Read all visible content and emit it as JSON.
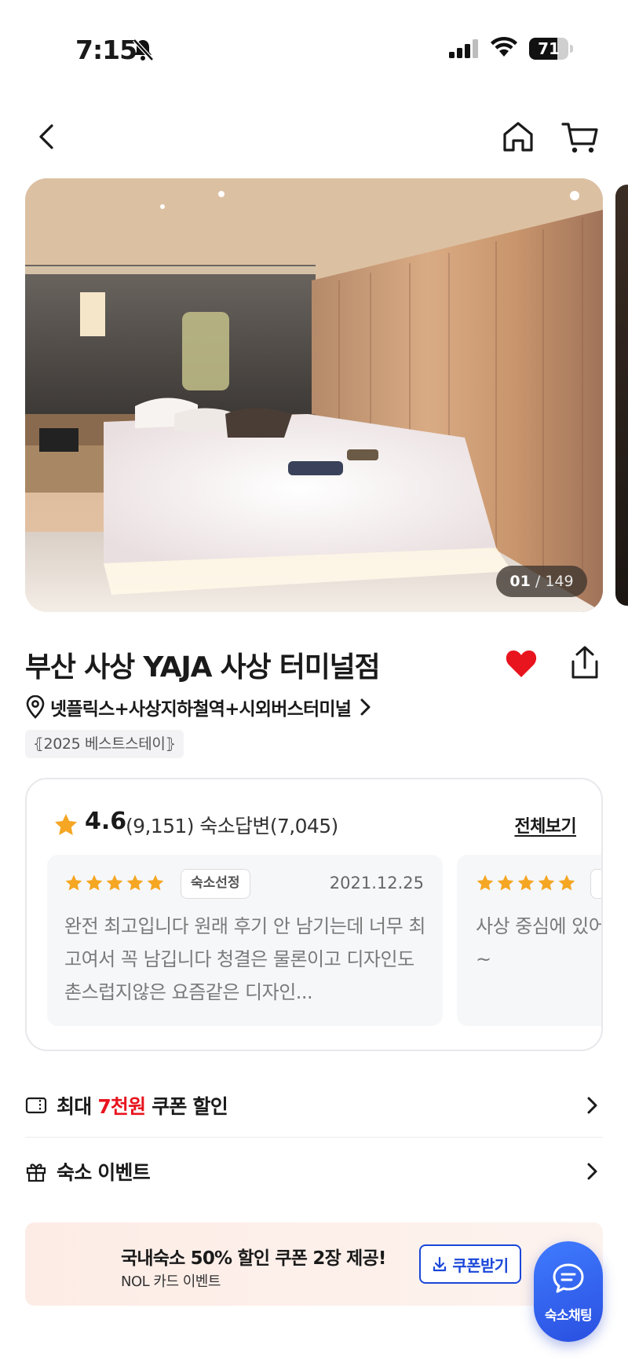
{
  "status_bar": {
    "time": "7:15",
    "battery": "71",
    "battery_level": 0.71
  },
  "gallery": {
    "current": "01",
    "separator": "/",
    "total": "149"
  },
  "hotel": {
    "name": "부산 사상 YAJA 사상 터미널점",
    "location": "넷플릭스+사상지하철역+시외버스터미널",
    "badge": "2025 베스트스테이",
    "liked": true
  },
  "reviews": {
    "rating": "4.6",
    "count_text": "(9,151) 숙소답변(7,045)",
    "view_all_label": "전체보기",
    "items": [
      {
        "stars": 5,
        "tag": "숙소선정",
        "date": "2021.12.25",
        "body": "완전 최고입니다 원래 후기 안 남기는데 너무 최고여서 꼭 남깁니다 청결은 물론이고 디자인도 촌스럽지않은 요즘같은 디자인..."
      },
      {
        "stars": 5,
        "tag": "",
        "date": "",
        "body": "사상 중심에 있어\n~"
      }
    ]
  },
  "list": {
    "coupon": {
      "prefix": "최대 ",
      "highlight": "7천원",
      "suffix": " 쿠폰 할인"
    },
    "event": {
      "label": "숙소 이벤트"
    }
  },
  "promo": {
    "title": "국내숙소 50% 할인 쿠폰 2장 제공!",
    "subtitle": "NOL 카드 이벤트",
    "button_label": "쿠폰받기"
  },
  "chat": {
    "label": "숙소채팅"
  },
  "colors": {
    "accent_red": "#e8141e",
    "accent_blue": "#1a47d9",
    "star": "#f5a623"
  }
}
